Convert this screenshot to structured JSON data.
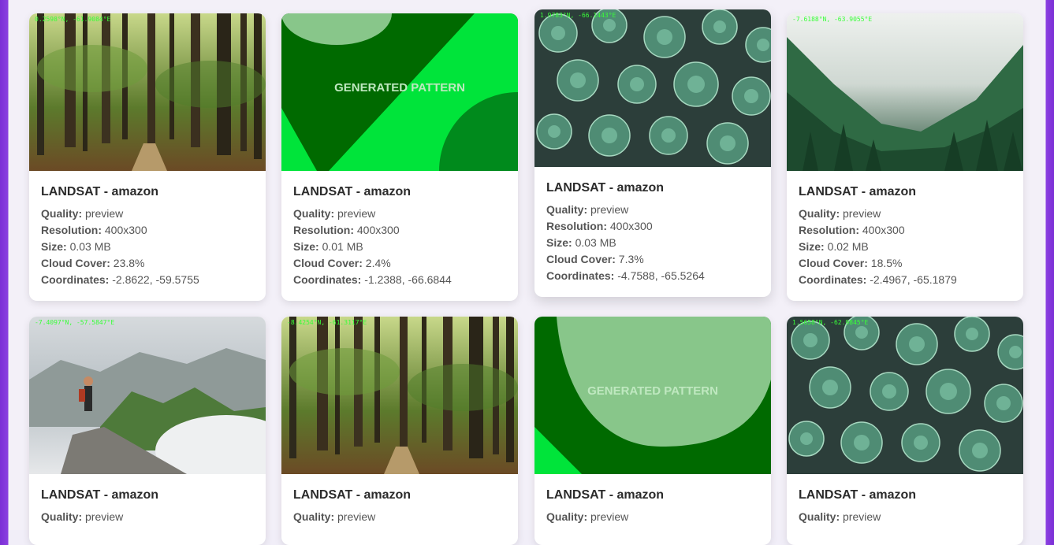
{
  "labels": {
    "quality": "Quality:",
    "resolution": "Resolution:",
    "size": "Size:",
    "cloud_cover": "Cloud Cover:",
    "coordinates": "Coordinates:"
  },
  "generated_label": "GENERATED PATTERN",
  "cards": [
    {
      "title": "LANDSAT - amazon",
      "image": "forest-path",
      "overlay": "0.2598°N, -61.9084°E",
      "quality": "preview",
      "resolution": "400x300",
      "size": "0.03 MB",
      "cloud_cover": "23.8%",
      "coordinates": "-2.8622, -59.5755"
    },
    {
      "title": "LANDSAT - amazon",
      "image": "generated-pattern",
      "overlay": "",
      "quality": "preview",
      "resolution": "400x300",
      "size": "0.01 MB",
      "cloud_cover": "2.4%",
      "coordinates": "-1.2388, -66.6844"
    },
    {
      "title": "LANDSAT - amazon",
      "image": "succulents",
      "overlay": "1.9783°N, -66.1443°E",
      "quality": "preview",
      "resolution": "400x300",
      "size": "0.03 MB",
      "cloud_cover": "7.3%",
      "coordinates": "-4.7588, -65.5264"
    },
    {
      "title": "LANDSAT - amazon",
      "image": "misty-forest",
      "overlay": "-7.6188°N, -63.9055°E",
      "quality": "preview",
      "resolution": "400x300",
      "size": "0.02 MB",
      "cloud_cover": "18.5%",
      "coordinates": "-2.4967, -65.1879"
    },
    {
      "title": "LANDSAT - amazon",
      "image": "mountain-hiker",
      "overlay": "-7.4097°N, -57.5847°E",
      "quality": "preview"
    },
    {
      "title": "LANDSAT - amazon",
      "image": "forest-path",
      "overlay": "-8.4254°N, -61.3117°E",
      "quality": "preview"
    },
    {
      "title": "LANDSAT - amazon",
      "image": "generated-pattern",
      "overlay": "",
      "quality": "preview"
    },
    {
      "title": "LANDSAT - amazon",
      "image": "succulents",
      "overlay": "1.5658°N, -62.9845°E",
      "quality": "preview"
    }
  ]
}
